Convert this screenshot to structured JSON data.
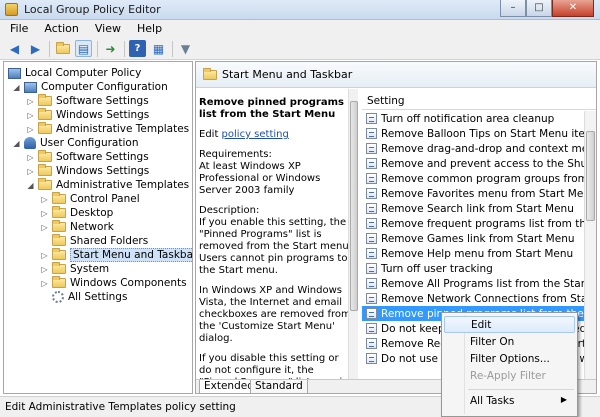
{
  "window": {
    "title": "Local Group Policy Editor",
    "minimize": "–",
    "maximize": "□",
    "close": "✕"
  },
  "menu": [
    "File",
    "Action",
    "View",
    "Help"
  ],
  "toolbar_icons": [
    "back-arrow-icon",
    "forward-arrow-icon",
    "up-folder-icon",
    "show-hide-tree-icon",
    "export-list-icon",
    "help-icon",
    "properties-icon",
    "filter-icon"
  ],
  "tree": [
    {
      "label": "Local Computer Policy",
      "icon": "pc-icon",
      "expander": ""
    },
    {
      "label": "Computer Configuration",
      "icon": "pc-icon",
      "expander": "◢"
    },
    {
      "label": "Software Settings",
      "icon": "folder-icon",
      "expander": "▷"
    },
    {
      "label": "Windows Settings",
      "icon": "folder-icon",
      "expander": "▷"
    },
    {
      "label": "Administrative Templates",
      "icon": "folder-icon",
      "expander": "▷"
    },
    {
      "label": "User Configuration",
      "icon": "user-icon",
      "expander": "◢"
    },
    {
      "label": "Software Settings",
      "icon": "folder-icon",
      "expander": "▷"
    },
    {
      "label": "Windows Settings",
      "icon": "folder-icon",
      "expander": "▷"
    },
    {
      "label": "Administrative Templates",
      "icon": "folder-icon",
      "expander": "◢"
    },
    {
      "label": "Control Panel",
      "icon": "folder-icon",
      "expander": "▷"
    },
    {
      "label": "Desktop",
      "icon": "folder-icon",
      "expander": "▷"
    },
    {
      "label": "Network",
      "icon": "folder-icon",
      "expander": "▷"
    },
    {
      "label": "Shared Folders",
      "icon": "folder-icon",
      "expander": ""
    },
    {
      "label": "Start Menu and Taskbar",
      "icon": "folder-icon",
      "expander": "▷",
      "selected": true
    },
    {
      "label": "System",
      "icon": "folder-icon",
      "expander": "▷"
    },
    {
      "label": "Windows Components",
      "icon": "folder-icon",
      "expander": "▷"
    },
    {
      "label": "All Settings",
      "icon": "gear-icon",
      "expander": ""
    }
  ],
  "panel": {
    "header": "Start Menu and Taskbar",
    "description": {
      "title": "Remove pinned programs list from the Start Menu",
      "edit_prefix": "Edit ",
      "edit_link": "policy setting",
      "requirements_label": "Requirements:",
      "requirements": "At least Windows XP Professional or Windows Server 2003 family",
      "description_label": "Description:",
      "para1": "If you enable this setting, the \"Pinned Programs\" list is removed from the Start menu. Users cannot pin programs to the Start menu.",
      "para2": "In Windows XP and Windows Vista, the Internet and email checkboxes are removed from the 'Customize Start Menu' dialog.",
      "para3": "If you disable this setting or do not configure it, the \"Pinned Programs\" list remains on the"
    },
    "column_header": "Setting",
    "settings": [
      "Turn off notification area cleanup",
      "Remove Balloon Tips on Start Menu items",
      "Remove drag-and-drop and context menus on the Start Menu",
      "Remove and prevent access to the Shut Down, Restart, Sleep, and Hibernate commands",
      "Remove common program groups from Start Menu",
      "Remove Favorites menu from Start Menu",
      "Remove Search link from Start Menu",
      "Remove frequent programs list from the Start Menu",
      "Remove Games link from Start Menu",
      "Remove Help menu from Start Menu",
      "Turn off user tracking",
      "Remove All Programs list from the Start menu",
      "Remove Network Connections from Start Menu",
      "Remove pinned programs list from the Start Menu",
      "Do not keep history of recently opened documents",
      "Remove Recent Items menu from Start Menu",
      "Do not use the search-based method when resolving shell shortcuts"
    ],
    "selected_index": 13,
    "tabs": [
      "Extended",
      "Standard"
    ]
  },
  "context_menu": {
    "items": [
      "Edit",
      "Filter On",
      "Filter Options...",
      "Re-Apply Filter",
      "All Tasks"
    ],
    "arrow": "▶"
  },
  "status": "Edit Administrative Templates policy setting"
}
